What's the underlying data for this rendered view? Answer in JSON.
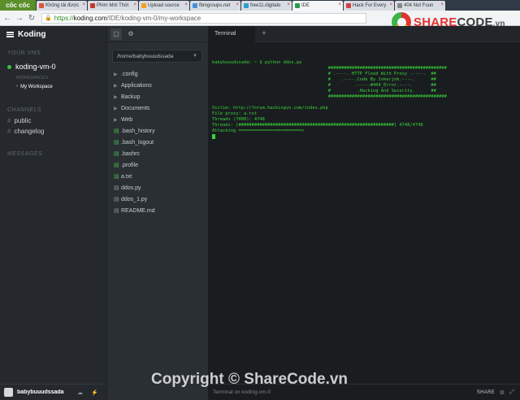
{
  "browser": {
    "logo": "cốc cốc",
    "tabs": [
      {
        "label": "Không tải được",
        "color": "#d9553f",
        "active": false
      },
      {
        "label": "Phim Mới Thời",
        "color": "#c03a2b",
        "active": false
      },
      {
        "label": "Upload source",
        "color": "#f0a020",
        "active": false
      },
      {
        "label": "fbmgroups.net",
        "color": "#4a90d9",
        "active": false
      },
      {
        "label": "free11.digitalo",
        "color": "#2aa0d0",
        "active": false
      },
      {
        "label": "IDE",
        "color": "#2b9a4a",
        "active": true
      },
      {
        "label": "Hack For Every",
        "color": "#d04040",
        "active": false
      },
      {
        "label": "404 Not Foun",
        "color": "#888888",
        "active": false
      }
    ],
    "url_scheme": "https://",
    "url_host": "koding.com",
    "url_path": "/IDE/koding-vm-0/my-workspace"
  },
  "sidebar": {
    "brand": "Koding",
    "your_vms_label": "YOUR VMS",
    "vm_name": "koding-vm-0",
    "workspaces_label": "WORKSPACES",
    "workspace_item": "My Workspace",
    "channels_label": "CHANNELS",
    "channels": [
      "public",
      "changelog"
    ],
    "messages_label": "MESSAGES",
    "username": "babybuuudssada"
  },
  "filetree": {
    "path": "/home/babybuuudssada",
    "items": [
      {
        "name": ".config",
        "type": "folder"
      },
      {
        "name": "Applications",
        "type": "folder"
      },
      {
        "name": "Backup",
        "type": "folder"
      },
      {
        "name": "Documents",
        "type": "folder"
      },
      {
        "name": "Web",
        "type": "folder"
      },
      {
        "name": ".bash_history",
        "type": "file-green"
      },
      {
        "name": ".bash_logout",
        "type": "file-green"
      },
      {
        "name": ".bashrc",
        "type": "file-green"
      },
      {
        "name": ".profile",
        "type": "file-green"
      },
      {
        "name": "a.txt",
        "type": "file-green"
      },
      {
        "name": "ddos.py",
        "type": "file"
      },
      {
        "name": "ddos_1.py",
        "type": "file"
      },
      {
        "name": "README.md",
        "type": "file"
      }
    ]
  },
  "terminal": {
    "tab_label": "Terminal",
    "add_tab": "+",
    "lines": [
      "babybuuudssada: ~ $ python ddos.py",
      "                                            #############################################",
      "                                            # .----. HTTP Flood With Proxy .----.  ##",
      "                                            #    .----.Code By Jokerjnk.----.      ##",
      "                                            #         .----.#404_Error.----.       ##",
      "                                            #          .Hacking And Security.      ##",
      "                                            #############################################",
      "",
      "Victim: http://forum.hackingvn.com/index.php",
      "File proxy: a.txt",
      "Threads (7000): 4748",
      "Threads: [###########################################################] 4748/4748",
      "Attacking ========================>"
    ],
    "status_text": "Terminal on koding-vm-0",
    "share_label": "SHARE"
  },
  "watermarks": {
    "logo_share": "SHARE",
    "logo_code": "CODE",
    "logo_vn": ".vn",
    "copyright": "Copyright © ShareCode.vn"
  }
}
